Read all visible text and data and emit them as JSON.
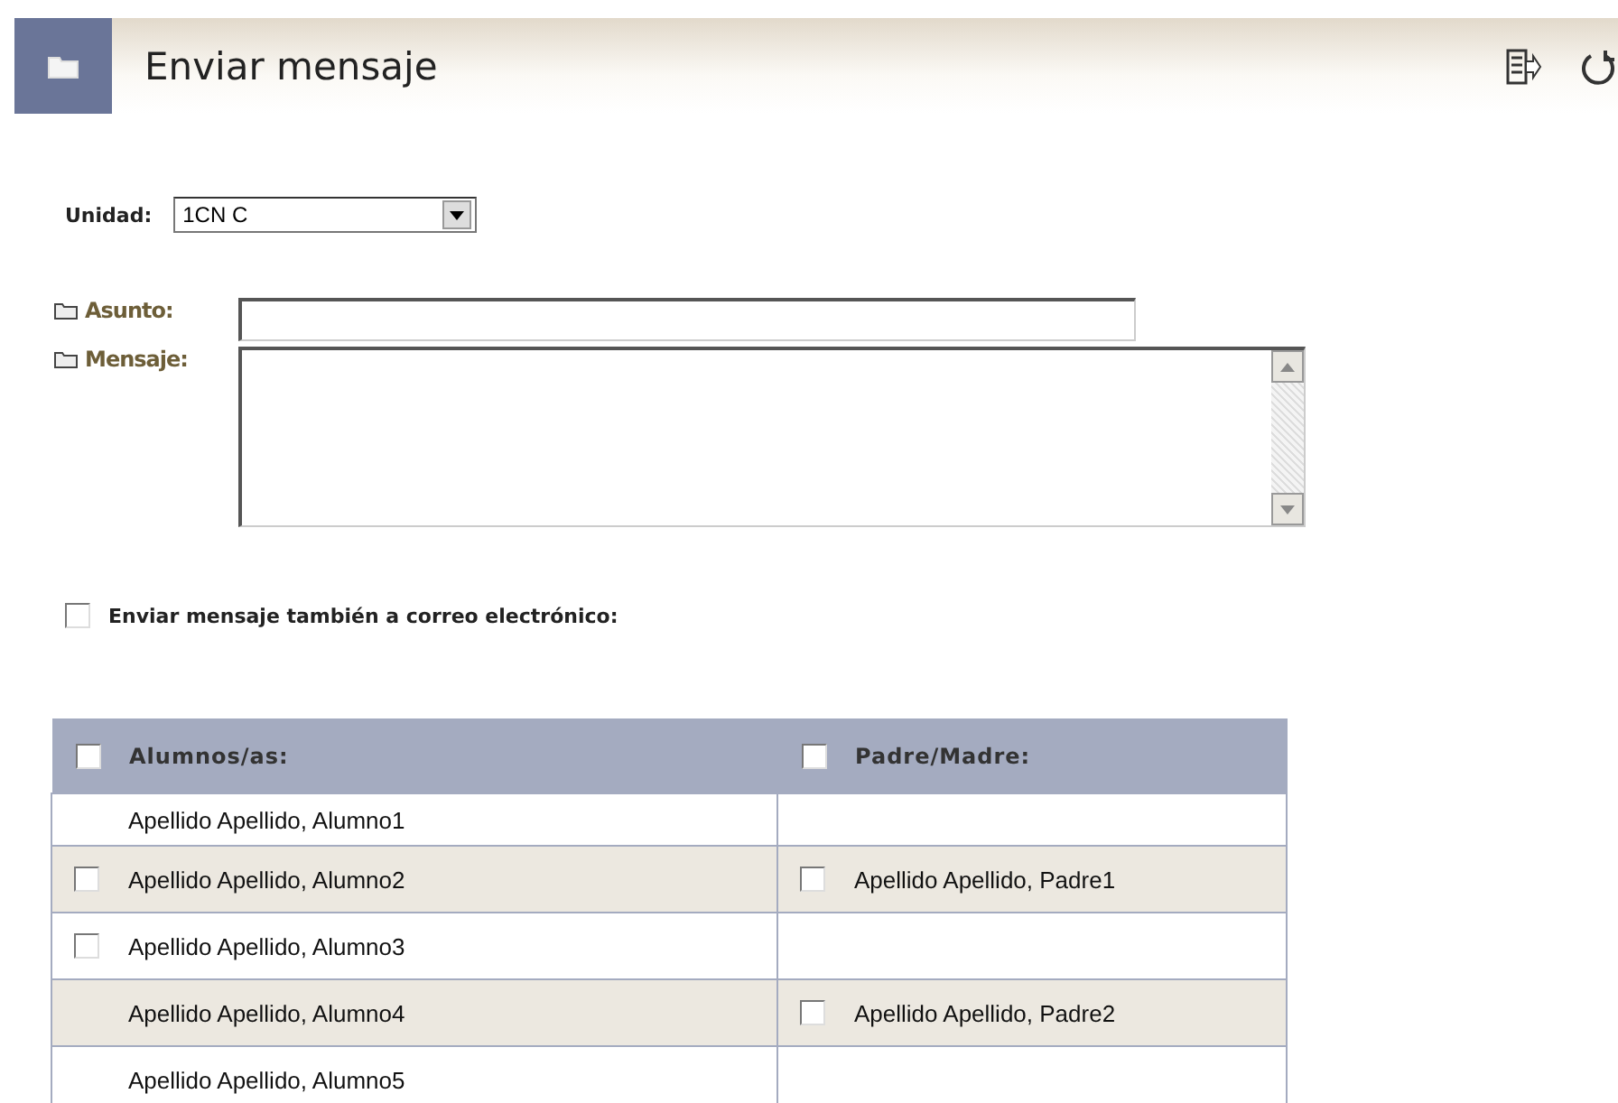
{
  "header": {
    "title": "Enviar mensaje"
  },
  "unidad": {
    "label": "Unidad:",
    "value": "1CN C"
  },
  "asunto": {
    "label": "Asunto:"
  },
  "mensaje": {
    "label": "Mensaje:"
  },
  "email_option": {
    "label": "Enviar mensaje también a correo electrónico:",
    "checked": false
  },
  "table": {
    "columns": [
      {
        "label": "Alumnos/as:",
        "checked": false
      },
      {
        "label": "Padre/Madre:",
        "checked": false
      }
    ],
    "rows": [
      {
        "student": {
          "name": "Apellido Apellido, Alumno1",
          "kind": "plain"
        }
      },
      {
        "student": {
          "name": "Apellido Apellido, Alumno2",
          "kind": "checkbox",
          "checked": false
        },
        "parent": {
          "name": "Apellido Apellido, Padre1",
          "checked": false
        }
      },
      {
        "student": {
          "name": "Apellido Apellido, Alumno3",
          "kind": "checkbox",
          "checked": false
        }
      },
      {
        "student": {
          "name": "Apellido Apellido, Alumno4",
          "kind": "plain"
        },
        "parent": {
          "name": "Apellido Apellido, Padre2",
          "checked": false
        }
      },
      {
        "student": {
          "name": "Apellido Apellido, Alumno5",
          "kind": "plain"
        }
      }
    ]
  }
}
